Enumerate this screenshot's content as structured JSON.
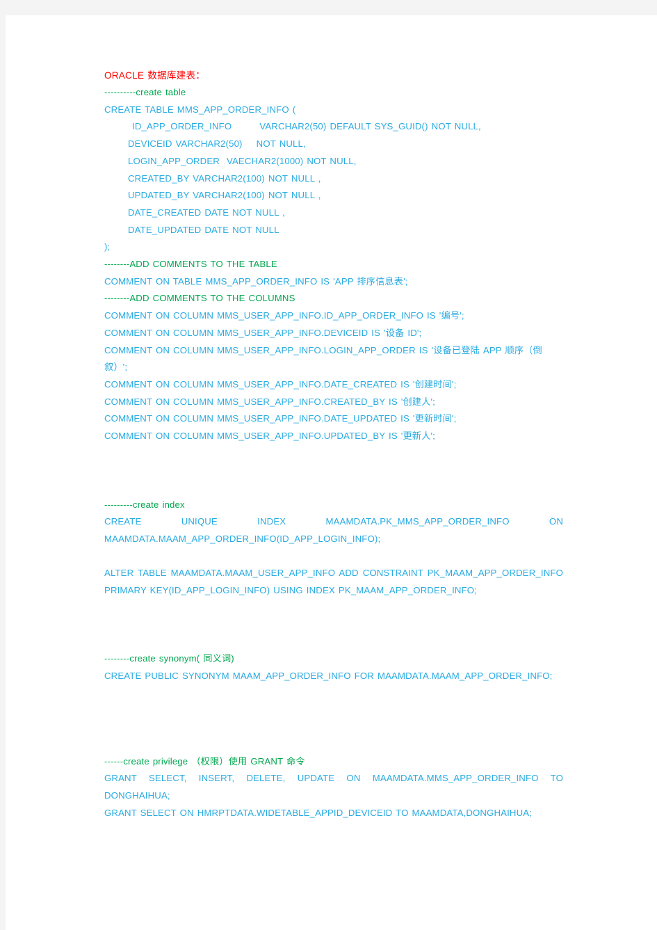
{
  "document": {
    "title": "ORACLE 数据库建表：",
    "colors": {
      "title": "#ff0000",
      "comment": "#00a64f",
      "sql": "#29abe2",
      "page_background": "#ffffff",
      "canvas_background": "#f4f4f4"
    },
    "sections": {
      "create_table": {
        "comment": "----------create table",
        "header": "CREATE TABLE MMS_APP_ORDER_INFO (",
        "columns": [
          "ID_APP_ORDER_INFO        VARCHAR2(50) DEFAULT SYS_GUID() NOT NULL,",
          "DEVICEID VARCHAR2(50)    NOT NULL,",
          "LOGIN_APP_ORDER  VAECHAR2(1000) NOT NULL,",
          "CREATED_BY VARCHAR2(100) NOT NULL ,",
          "UPDATED_BY VARCHAR2(100) NOT NULL ,",
          "DATE_CREATED DATE NOT NULL ,",
          "DATE_UPDATED DATE NOT NULL"
        ],
        "footer": ");"
      },
      "table_comments": {
        "comment": "--------ADD COMMENTS TO THE TABLE",
        "statement": "COMMENT ON TABLE MMS_APP_ORDER_INFO IS 'APP 排序信息表';"
      },
      "column_comments": {
        "comment": "--------ADD COMMENTS TO THE COLUMNS",
        "statements": [
          "COMMENT ON COLUMN MMS_USER_APP_INFO.ID_APP_ORDER_INFO IS '编号';",
          "COMMENT ON COLUMN MMS_USER_APP_INFO.DEVICEID IS '设备 ID';",
          "COMMENT ON COLUMN MMS_USER_APP_INFO.LOGIN_APP_ORDER IS '设备已登陆 APP 顺序（倒叙）';",
          "COMMENT ON COLUMN MMS_USER_APP_INFO.DATE_CREATED IS '创建时间';",
          "COMMENT ON COLUMN MMS_USER_APP_INFO.CREATED_BY IS '创建人';",
          "COMMENT ON COLUMN MMS_USER_APP_INFO.DATE_UPDATED IS '更新时间';",
          "COMMENT ON COLUMN MMS_USER_APP_INFO.UPDATED_BY IS '更新人';"
        ]
      },
      "create_index": {
        "comment": "---------create index",
        "statement": "CREATE UNIQUE INDEX MAAMDATA.PK_MMS_APP_ORDER_INFO ON MAAMDATA.MAAM_APP_ORDER_INFO(ID_APP_LOGIN_INFO);",
        "alter_statement": "ALTER TABLE MAAMDATA.MAAM_USER_APP_INFO ADD CONSTRAINT PK_MAAM_APP_ORDER_INFO PRIMARY KEY(ID_APP_LOGIN_INFO) USING INDEX PK_MAAM_APP_ORDER_INFO;"
      },
      "create_synonym": {
        "comment": "--------create synonym( 同义词)",
        "statement": "CREATE PUBLIC SYNONYM MAAM_APP_ORDER_INFO FOR MAAMDATA.MAAM_APP_ORDER_INFO;"
      },
      "create_privilege": {
        "comment": "------create privilege （权限）使用 GRANT 命令",
        "statements": [
          "GRANT SELECT, INSERT, DELETE, UPDATE ON MAAMDATA.MMS_APP_ORDER_INFO TO DONGHAIHUA;",
          "GRANT SELECT ON HMRPTDATA.WIDETABLE_APPID_DEVICEID TO MAAMDATA,DONGHAIHUA;"
        ]
      }
    }
  }
}
